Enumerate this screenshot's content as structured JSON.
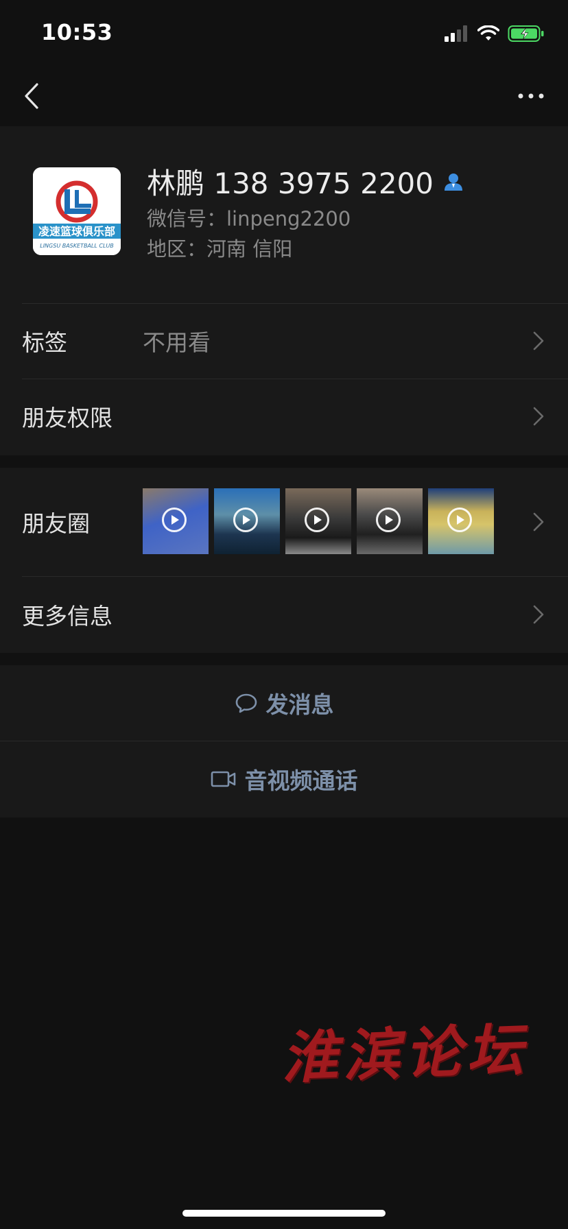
{
  "status_bar": {
    "time": "10:53"
  },
  "nav": {
    "back_icon": "chevron-left-icon",
    "more_icon": "more-horizontal-icon"
  },
  "profile": {
    "name": "林鹏 138 3975 2200",
    "wechat_id": "微信号：linpeng2200",
    "region": "地区：河南 信阳",
    "avatar_logo_text": "凌速篮球俱乐部",
    "avatar_logo_subtext": "LINGSU BASKETBALL CLUB",
    "contact_icon": "contact-person-icon"
  },
  "rows": {
    "tags_label": "标签",
    "tags_value": "不用看",
    "permissions_label": "朋友权限",
    "moments_label": "朋友圈",
    "more_info_label": "更多信息"
  },
  "moments": {
    "thumbnails": [
      {
        "kind": "video",
        "colors": [
          "#3f63c6",
          "#6b7ea0"
        ]
      },
      {
        "kind": "video",
        "colors": [
          "#2a6fb8",
          "#1d3550"
        ]
      },
      {
        "kind": "video",
        "colors": [
          "#5a5a5a",
          "#2a2a2a"
        ]
      },
      {
        "kind": "video",
        "colors": [
          "#6a6a6a",
          "#303030"
        ]
      },
      {
        "kind": "video",
        "colors": [
          "#c9b25a",
          "#3a6f9a"
        ]
      }
    ]
  },
  "actions": {
    "message_label": "发消息",
    "call_label": "音视频通话"
  },
  "watermark": {
    "text": "淮滨论坛"
  },
  "colors": {
    "background": "#111111",
    "card": "#191919",
    "link_blue": "#7d90a9",
    "battery_green": "#4cd964",
    "watermark_red": "#a01a1e"
  }
}
